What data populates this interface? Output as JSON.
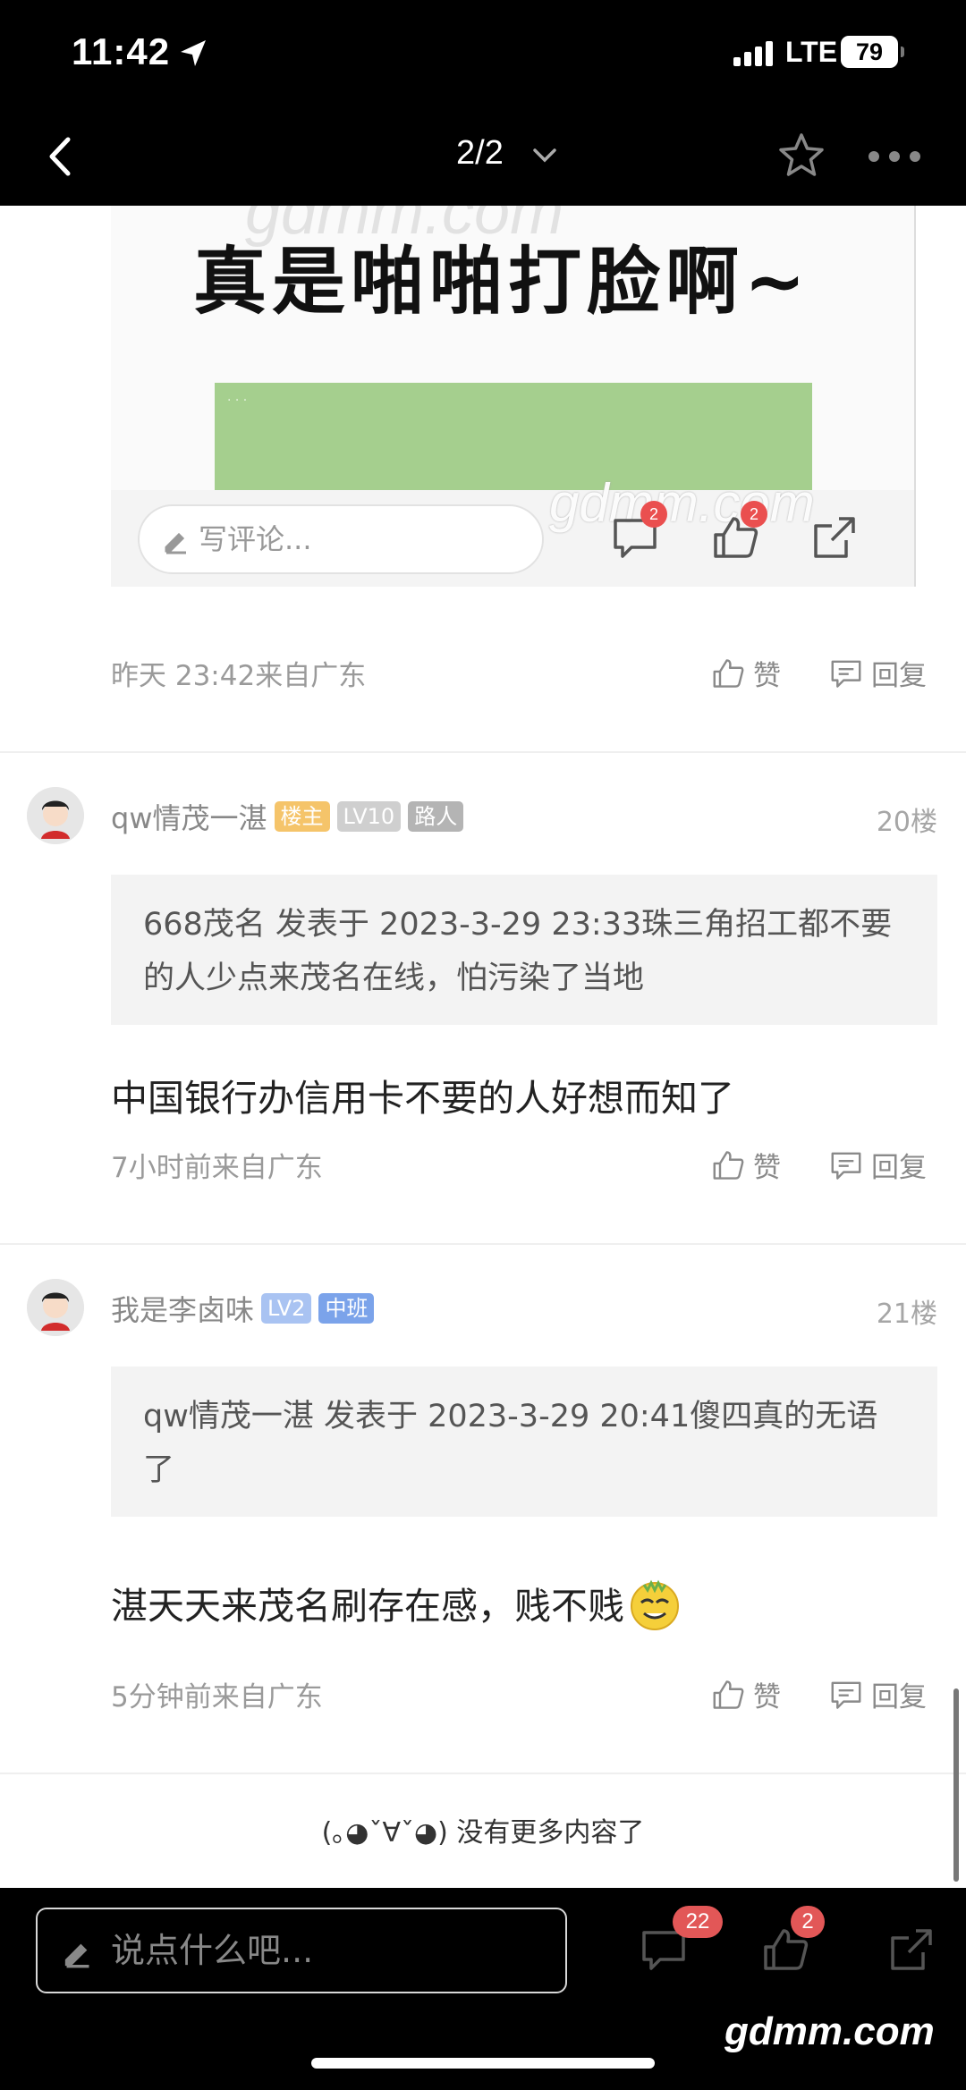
{
  "status_bar": {
    "time": "11:42",
    "network": "LTE",
    "battery": "79"
  },
  "nav": {
    "page_indicator": "2/2"
  },
  "quote_image": {
    "caption": "真是啪啪打脸啊~",
    "watermark": "gdmm.com",
    "comment_placeholder": "写评论...",
    "comment_badge": "2",
    "like_badge": "2"
  },
  "post_meta": {
    "time": "昨天 23:42来自广东",
    "like_label": "赞",
    "reply_label": "回复"
  },
  "replies": [
    {
      "username": "qw情茂一湛",
      "tags": [
        "楼主",
        "LV10",
        "路人"
      ],
      "floor": "20楼",
      "quote": "668茂名 发表于 2023-3-29 23:33珠三角招工都不要的人少点来茂名在线，怕污染了当地",
      "text": "中国银行办信用卡不要的人好想而知了",
      "time": "7小时前来自广东",
      "like_label": "赞",
      "reply_label": "回复"
    },
    {
      "username": "我是李卤味",
      "tags": [
        "LV2",
        "中班"
      ],
      "floor": "21楼",
      "quote": "qw情茂一湛 发表于 2023-3-29 20:41傻四真的无语了",
      "text": "湛天天来茂名刷存在感，贱不贱",
      "time": "5分钟前来自广东",
      "like_label": "赞",
      "reply_label": "回复"
    }
  ],
  "end_message": "(｡◕ˇ∀ˇ◕) 没有更多内容了",
  "bottom_bar": {
    "input_placeholder": "说点什么吧...",
    "comment_count": "22",
    "like_count": "2",
    "watermark": "gdmm.com"
  },
  "icons": [
    "location-arrow-icon",
    "signal-icon",
    "battery-icon",
    "back-icon",
    "chevron-down-icon",
    "star-icon",
    "more-icon",
    "pencil-icon",
    "comment-icon",
    "thumbs-up-icon",
    "share-icon",
    "reply-icon",
    "emoji-icon"
  ],
  "colors": {
    "bar_bg": "#000000",
    "badge": "#e25757",
    "owner_tag": "#f5c46a",
    "level_blue": "#a9c3f2",
    "image_green": "#a5cf8e"
  }
}
